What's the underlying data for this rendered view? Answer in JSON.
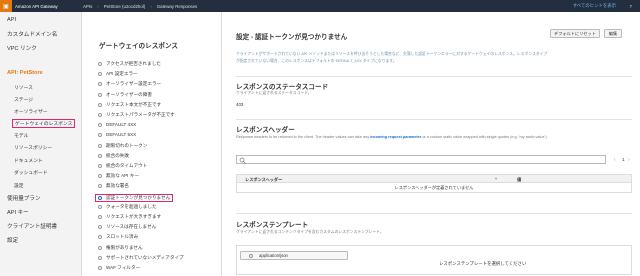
{
  "topbar": {
    "logo": "▣",
    "app_name": "Amazon API Gateway",
    "crumbs": [
      "APIs",
      "PetStore (u2ocd2hol)",
      "Gateway Responses"
    ],
    "show_help": "すべてのヒントを表示",
    "help_icon": "?"
  },
  "leftnav": {
    "api": "API",
    "custom_domain": "カスタムドメイン名",
    "vpc_link": "VPC リンク",
    "api_label": "API:",
    "api_name": "PetStore",
    "resources": "リソース",
    "stages": "ステージ",
    "authorizers": "オーソライザー",
    "gateway_responses": "ゲートウェイのレスポンス",
    "models": "モデル",
    "resource_policy": "リソースポリシー",
    "documentation": "ドキュメント",
    "dashboard": "ダッシュボード",
    "settings": "設定",
    "usage_plans": "使用量プラン",
    "api_keys": "API キー",
    "client_certs": "クライアント証明書",
    "settings2": "設定"
  },
  "responses": {
    "title": "ゲートウェイのレスポンス",
    "items": [
      "アクセスが拒否されました",
      "API 設定エラー",
      "オーソライザー設定エラー",
      "オーソライザーの障害",
      "リクエスト本文が不正です",
      "リクエストパラメータが不正です",
      "DEFAULT 4XX",
      "DEFAULT 5XX",
      "期限切れのトークン",
      "統合の失敗",
      "統合のタイムアウト",
      "無効な API キー",
      "無効な署名",
      "認証トークンが見つかりません",
      "クォータを超過しました",
      "リクエストが大きすぎます",
      "リソースは存在しません",
      "スロットル済み",
      "権限がありません",
      "サポートされていないメディアタイプ",
      "WAF フィルター"
    ],
    "selected_index": 13
  },
  "detail": {
    "title": "設定 - 認証トークンが見つかりません",
    "btn_reset": "デフォルトにリセット",
    "btn_edit": "編集",
    "desc1": "クライアントがサポートされていない API メソッドまたはリソースを呼び出そうとした場合など、欠落した認証トークンエラーに対するゲートウェイのレスポンス。レスポンスタイプ",
    "desc2": "が指定されていない場合、このレスポンスはデフォルトの DEFAULT_4XX タイプになります。",
    "status_title": "レスポンスのステータスコード",
    "status_desc": "クライアントに返されるステータスコード。",
    "status_code": "403",
    "headers_title": "レスポンスヘッダー",
    "headers_desc1": "Response headers to be returned to the client. The header values can take any",
    "headers_link": "incoming request parameter",
    "headers_desc2": "or a custom static value wrapped with single quotes (e.g. 'my static value').",
    "search_icon": "search-icon",
    "page_prev": "‹",
    "page_num": "1",
    "page_next": "›",
    "col_header": "レスポンスヘッダー",
    "col_value": "値",
    "empty_headers": "レスポンスヘッダーが定義されていません",
    "tmpl_title": "レスポンステンプレート",
    "tmpl_desc": "クライアントに返されるコンテンツタイプを含むカスタムのレスポンステンプレート。",
    "tmpl_type": "application/json",
    "tmpl_empty": "レスポンステンプレートを選択してください"
  }
}
